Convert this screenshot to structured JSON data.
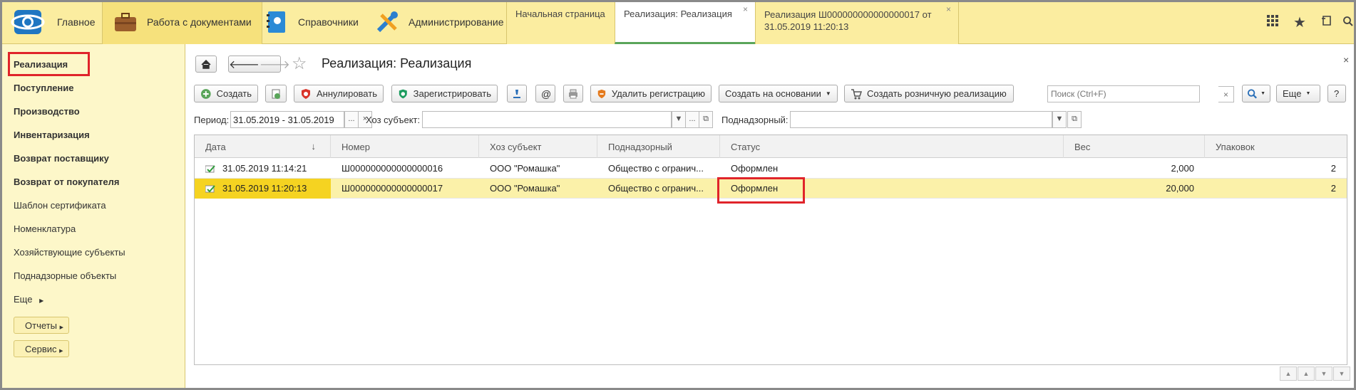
{
  "topbar": {
    "main_label": "Главное",
    "sections": [
      "Работа с документами",
      "Справочники",
      "Администрирование"
    ],
    "tabs": [
      {
        "label": "Начальная страница"
      },
      {
        "label": "Реализация: Реализация",
        "close": "×"
      },
      {
        "label": "Реализация Ш000000000000000017 от 31.05.2019 11:20:13",
        "close": "×"
      }
    ]
  },
  "sidebar": {
    "items": [
      "Реализация",
      "Поступление",
      "Производство",
      "Инвентаризация",
      "Возврат поставщику",
      "Возврат от покупателя",
      "Шаблон сертификата",
      "Номенклатура",
      "Хозяйствующие субъекты",
      "Поднадзорные объекты",
      "Еще"
    ],
    "buttons": [
      "Отчеты",
      "Сервис"
    ]
  },
  "header": {
    "title": "Реализация: Реализация"
  },
  "toolbar": {
    "create": "Создать",
    "annul": "Аннулировать",
    "register": "Зарегистрировать",
    "at": "@",
    "delete_registration": "Удалить регистрацию",
    "create_based_on": "Создать на основании",
    "create_retail": "Создать розничную реализацию",
    "search_placeholder": "Поиск (Ctrl+F)",
    "more": "Еще",
    "help": "?"
  },
  "filters": {
    "period_label": "Период:",
    "period_value": "31.05.2019 - 31.05.2019",
    "subject_label": "Хоз субъект:",
    "subject_value": "",
    "supervised_label": "Поднадзорный:",
    "supervised_value": ""
  },
  "table": {
    "columns": [
      "Дата",
      "Номер",
      "Хоз субъект",
      "Поднадзорный",
      "Статус",
      "Вес",
      "Упаковок"
    ],
    "rows": [
      {
        "date": "31.05.2019 11:14:21",
        "number": "Ш000000000000000016",
        "subject": "ООО \"Ромашка\"",
        "supervised": "Общество с огранич...",
        "status": "Оформлен",
        "weight": "2,000",
        "packages": "2"
      },
      {
        "date": "31.05.2019 11:20:13",
        "number": "Ш000000000000000017",
        "subject": "ООО \"Ромашка\"",
        "supervised": "Общество с огранич...",
        "status": "Оформлен",
        "weight": "20,000",
        "packages": "2"
      }
    ]
  },
  "colors": {
    "topbar": "#fbeda0",
    "sidebar": "#fdf7c9",
    "selected_row": "#fbf1a9",
    "highlight_box": "#e0242a"
  }
}
